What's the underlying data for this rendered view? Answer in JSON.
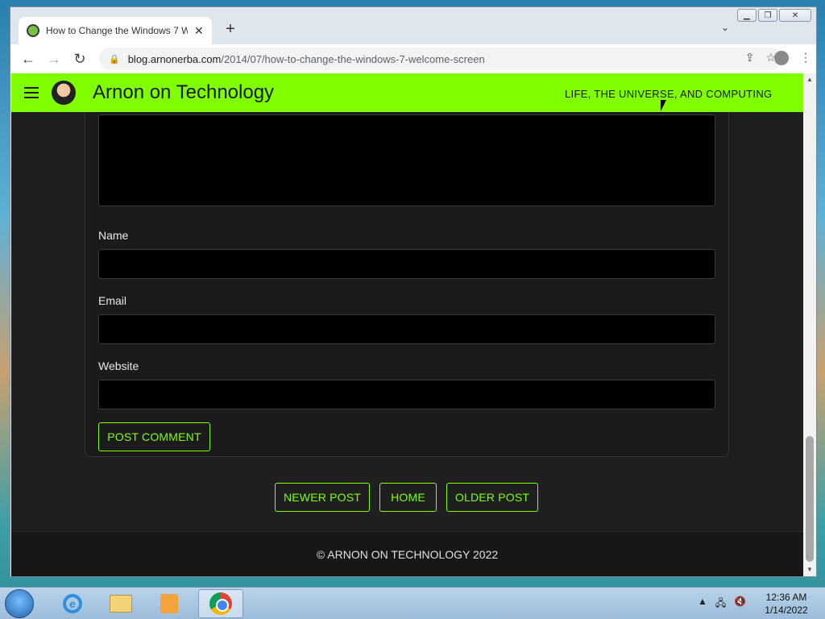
{
  "browser": {
    "tab_title": "How to Change the Windows 7 W",
    "url_domain": "blog.arnonerba.com",
    "url_path": "/2014/07/how-to-change-the-windows-7-welcome-screen"
  },
  "header": {
    "title": "Arnon on Technology",
    "tagline": "LIFE, THE UNIVERSE, AND COMPUTING"
  },
  "form": {
    "name_label": "Name",
    "email_label": "Email",
    "website_label": "Website",
    "submit_label": "POST COMMENT"
  },
  "pagination": {
    "newer": "NEWER POST",
    "home": "HOME",
    "older": "OLDER POST"
  },
  "footer": {
    "copyright": "© ARNON ON TECHNOLOGY 2022"
  },
  "taskbar": {
    "time": "12:36 AM",
    "date": "1/14/2022"
  },
  "colors": {
    "accent": "#7fff00",
    "page_bg": "#1f1f1f"
  }
}
